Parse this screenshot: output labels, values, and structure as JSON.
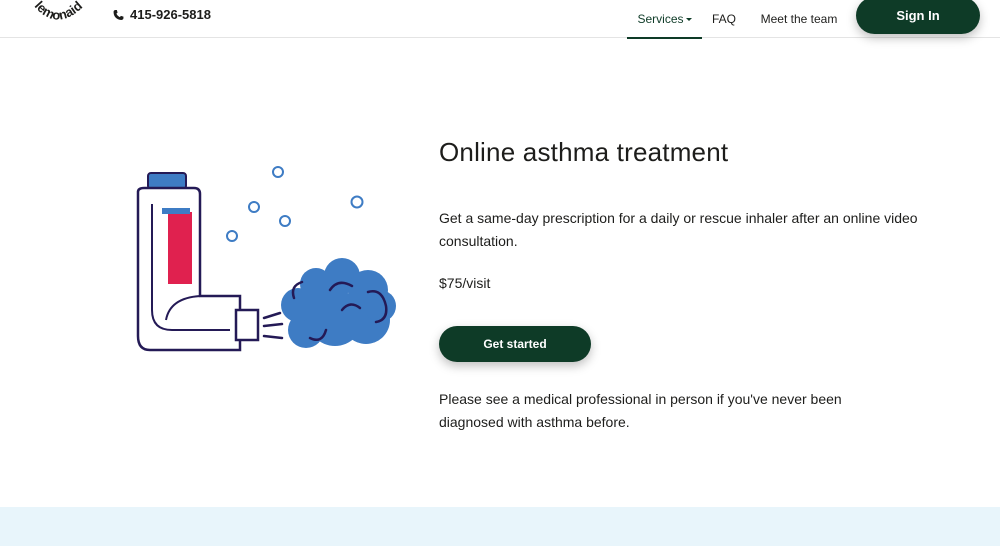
{
  "header": {
    "logo_text": "lemonaid",
    "phone": "415-926-5818",
    "nav": {
      "services": "Services",
      "faq": "FAQ",
      "team": "Meet the team"
    },
    "signin": "Sign In"
  },
  "hero": {
    "title": "Online asthma treatment",
    "description": "Get a same-day prescription for a daily or rescue inhaler after an online video consultation.",
    "price": "$75/visit",
    "cta": "Get started",
    "note": "Please see a medical professional in person if you've never been diagnosed with asthma before."
  },
  "colors": {
    "brand": "#0e3b27",
    "inhaler_blue": "#3e7cc4",
    "inhaler_red": "#e0214f",
    "outline": "#241a56",
    "band": "#e8f5fb"
  }
}
